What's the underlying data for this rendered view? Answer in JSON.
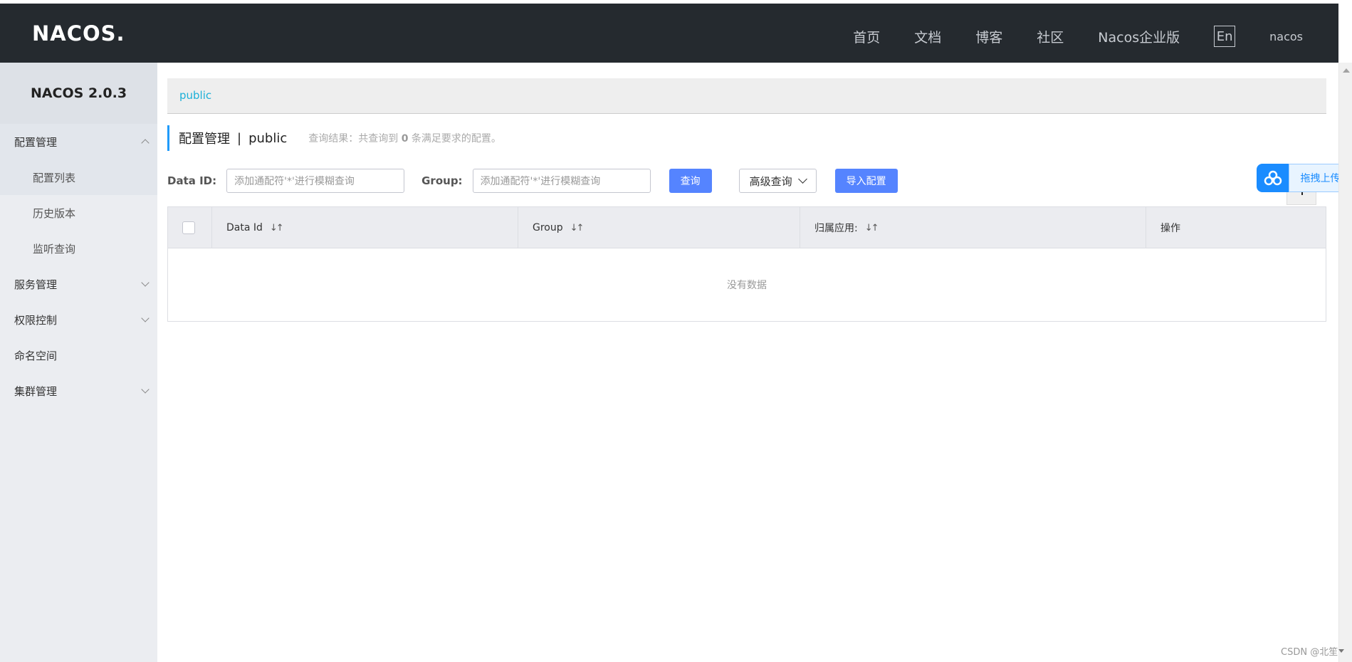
{
  "header": {
    "logo_text": "NACOS.",
    "nav": [
      "首页",
      "文档",
      "博客",
      "社区",
      "Nacos企业版"
    ],
    "lang_label": "En",
    "user": "nacos"
  },
  "sidebar": {
    "version": "NACOS 2.0.3",
    "items": [
      {
        "label": "配置管理"
      },
      {
        "label": "配置列表"
      },
      {
        "label": "历史版本"
      },
      {
        "label": "监听查询"
      },
      {
        "label": "服务管理"
      },
      {
        "label": "权限控制"
      },
      {
        "label": "命名空间"
      },
      {
        "label": "集群管理"
      }
    ]
  },
  "main": {
    "namespace_tab": "public",
    "title": "配置管理",
    "title_sep": "|",
    "title_ns": "public",
    "result_prefix": "查询结果：共查询到",
    "result_count": "0",
    "result_suffix": "条满足要求的配置。",
    "filters": {
      "data_id_label": "Data ID:",
      "data_id_placeholder": "添加通配符'*'进行模糊查询",
      "group_label": "Group:",
      "group_placeholder": "添加通配符'*'进行模糊查询",
      "query_button": "查询",
      "advanced_button": "高级查询",
      "import_button": "导入配置"
    },
    "table": {
      "columns": [
        "Data Id",
        "Group",
        "归属应用:",
        "操作"
      ],
      "sort_glyph": "↓↑",
      "empty_text": "没有数据"
    }
  },
  "upload_widget": {
    "label": "拖拽上传"
  },
  "watermark": "CSDN @北笙"
}
